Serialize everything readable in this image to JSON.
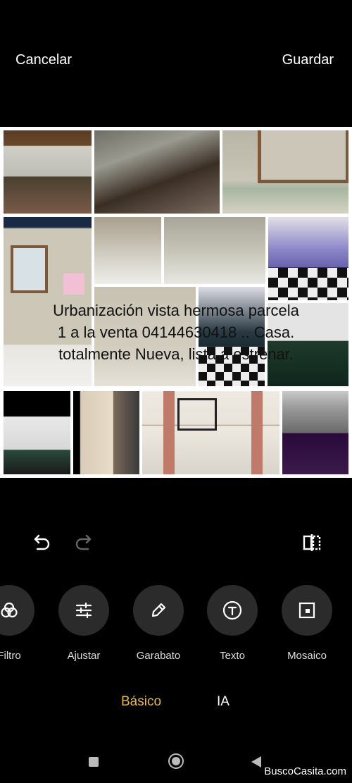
{
  "header": {
    "cancel_label": "Cancelar",
    "save_label": "Guardar"
  },
  "photo": {
    "overlay_text_1": "Urbanización vista hermosa parcela",
    "overlay_text_2": "1 a la venta 04144630418 .. Casa.",
    "overlay_text_3": "totalmente Nueva, lista a estrenar."
  },
  "tools": [
    {
      "label": "Filtro",
      "icon": "filter-icon"
    },
    {
      "label": "Ajustar",
      "icon": "adjust-icon"
    },
    {
      "label": "Garabato",
      "icon": "pencil-icon"
    },
    {
      "label": "Texto",
      "icon": "text-icon"
    },
    {
      "label": "Mosaico",
      "icon": "mosaic-icon"
    }
  ],
  "tabs": {
    "basic": "Básico",
    "ai": "IA"
  },
  "watermark": "BuscoCasita.com",
  "colors": {
    "accent": "#e8b84a",
    "background": "#000000",
    "tool_circle": "#2b2b2b"
  }
}
